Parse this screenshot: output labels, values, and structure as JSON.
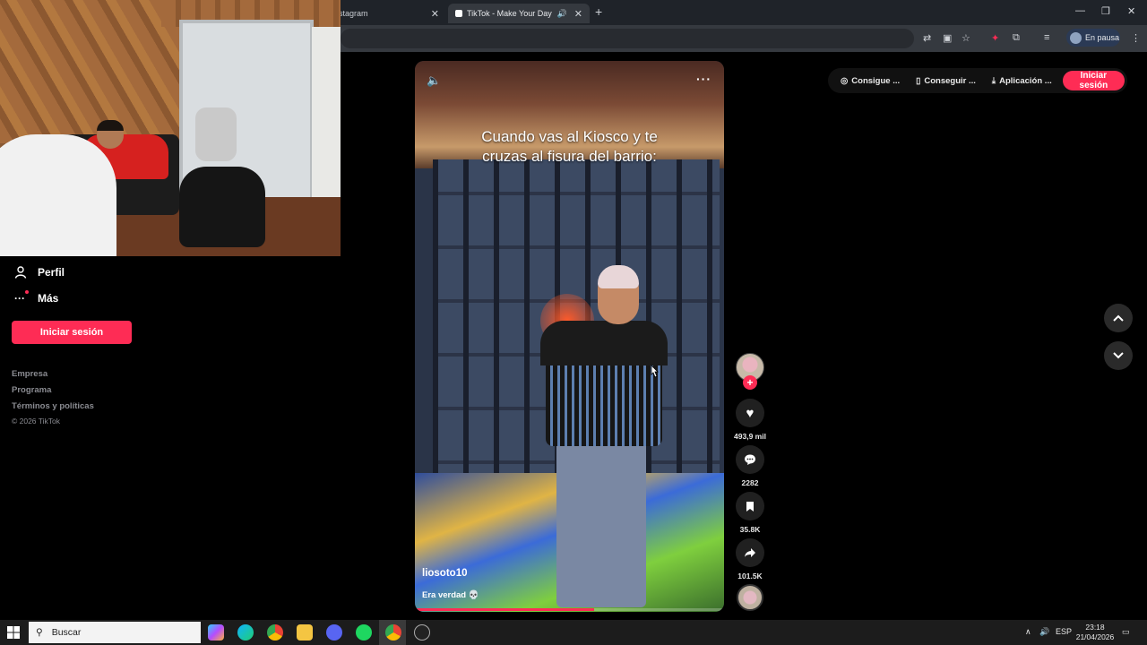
{
  "browser": {
    "tabs": [
      {
        "label": "stagram"
      },
      {
        "label": "TikTok - Make Your Day"
      }
    ],
    "profile_label": "En pausa"
  },
  "sidebar": {
    "items": [
      {
        "label": "Perfil",
        "icon": "person-icon"
      },
      {
        "label": "Más",
        "icon": "more-icon"
      }
    ],
    "login_label": "Iniciar sesión",
    "footer_links": [
      "Empresa",
      "Programa",
      "Términos y políticas"
    ],
    "copyright": "© 2026 TikTok"
  },
  "topbar": {
    "buttons": [
      {
        "label": "Consigue ...",
        "icon": "coin-icon"
      },
      {
        "label": "Conseguir ...",
        "icon": "phone-icon"
      },
      {
        "label": "Aplicación ...",
        "icon": "download-icon"
      }
    ],
    "login_label": "Iniciar sesión"
  },
  "video": {
    "caption_line1": "Cuando vas al Kiosco y te",
    "caption_line2": "cruzas al fisura del barrio:",
    "username": "liosoto10",
    "description": "Era verdad 💀",
    "progress": 0.58
  },
  "actions": {
    "likes": "493,9 mil",
    "comments": "2282",
    "saves": "35.8K",
    "shares": "101.5K"
  },
  "taskbar": {
    "search_placeholder": "Buscar",
    "language": "ESP",
    "time": "23:18",
    "date": "21/04/2026"
  },
  "colors": {
    "accent": "#fe2c55",
    "background": "#000000",
    "chrome_dark": "#1f2329",
    "chrome_toolbar": "#35393f"
  }
}
